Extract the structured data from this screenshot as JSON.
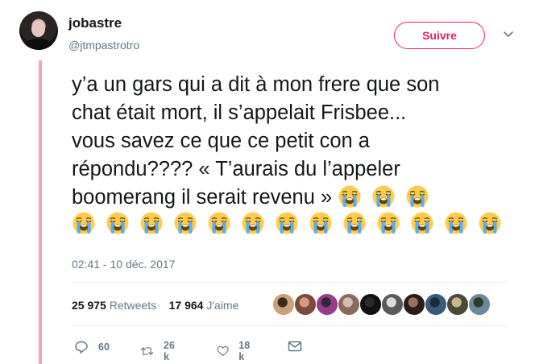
{
  "tweet": {
    "author": {
      "display_name": "jobastre",
      "handle": "@jtmpastrotro"
    },
    "follow_label": "Suivre",
    "text_lines": [
      "y’a un gars qui a dit à mon frere que son",
      "chat était mort, il s’appelait Frisbee...",
      "vous savez ce que ce petit con a",
      "répondu???? « T’aurais du l’appeler",
      "boomerang il serait revenu »"
    ],
    "emoji_name": "loudly-crying-face",
    "emoji_count_inline": 3,
    "emoji_count_row": 13,
    "timestamp": "02:41 - 10 déc. 2017",
    "retweets_count": "25 975",
    "retweets_label": "Retweets",
    "likes_count": "17 964",
    "likes_label": "J'aime",
    "liker_avatars_count": 10,
    "actions": {
      "reply_count": "60",
      "retweet_count": "26 k",
      "like_count": "18 k"
    }
  },
  "colors": {
    "accent_pink": "#e0245e",
    "thread_line": "#f3a3c0",
    "secondary_text": "#657786"
  }
}
